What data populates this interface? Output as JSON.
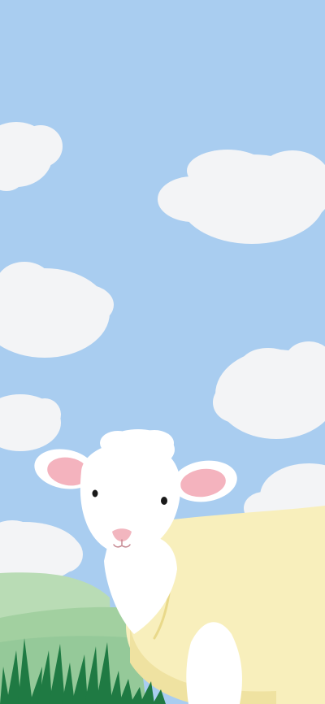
{
  "scene": {
    "subject": "sheep-illustration",
    "palette": {
      "sky": "#a9cdf0",
      "cloud": "#f3f4f6",
      "hill_light": "#b9dcb5",
      "hill_dark": "#95c999",
      "grass": "#1f7a43",
      "wool": "#ffffff",
      "ear_inner": "#f4b3be",
      "nose": "#f2b6bf",
      "blanket": "#f8efbc",
      "blanket_edge": "#efe2a1"
    }
  }
}
